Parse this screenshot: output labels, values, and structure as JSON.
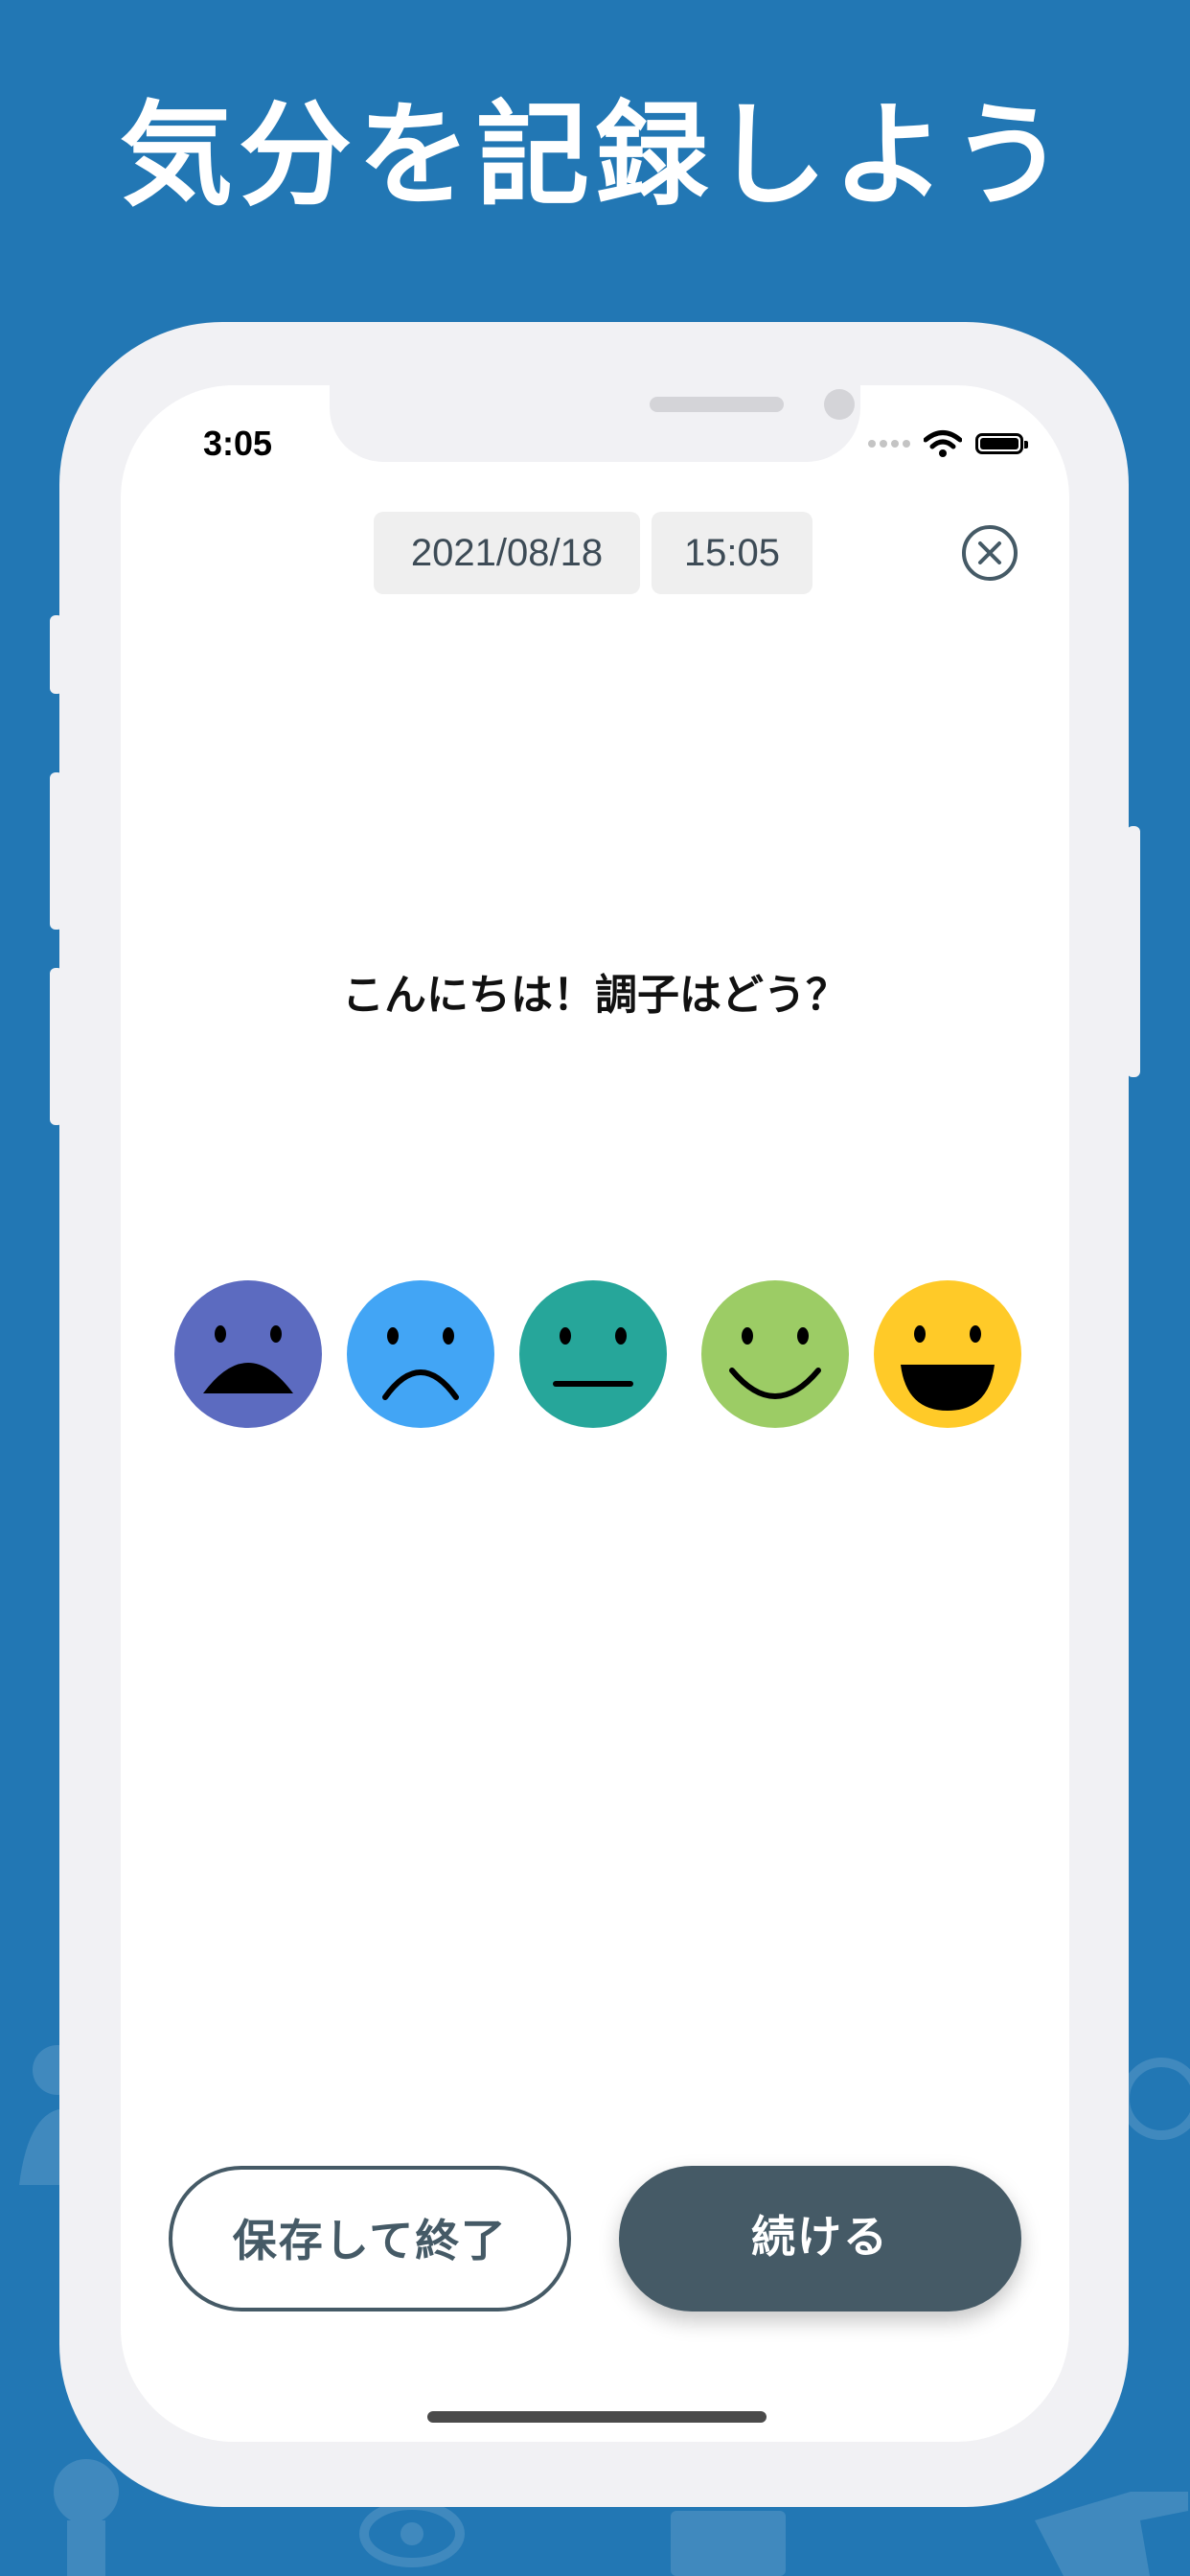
{
  "promo": {
    "headline": "気分を記録しよう"
  },
  "status_bar": {
    "time": "3:05"
  },
  "entry": {
    "date": "2021/08/18",
    "time": "15:05"
  },
  "prompt": {
    "question": "こんにちは！調子はどう？"
  },
  "moods": [
    {
      "id": "very-sad",
      "color": "#5c6bc0"
    },
    {
      "id": "sad",
      "color": "#42a5f5"
    },
    {
      "id": "neutral",
      "color": "#26a69a"
    },
    {
      "id": "happy",
      "color": "#9ccc65"
    },
    {
      "id": "very-happy",
      "color": "#ffca28"
    }
  ],
  "actions": {
    "save_label": "保存して終了",
    "continue_label": "続ける"
  },
  "colors": {
    "background": "#2277b4",
    "button_dark": "#455a66"
  }
}
